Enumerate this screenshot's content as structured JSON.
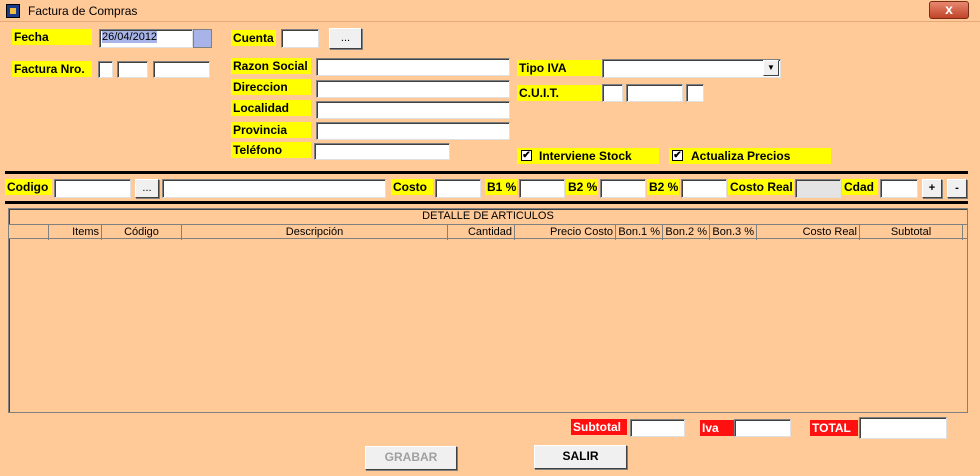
{
  "window": {
    "title": "Factura de Compras",
    "close_glyph": "x"
  },
  "header": {
    "fecha_label": "Fecha",
    "fecha_value": "26/04/2012",
    "factura_label": "Factura Nro.",
    "cuenta_label": "Cuenta",
    "cuenta_button": "...",
    "razon_social_label": "Razon Social",
    "direccion_label": "Direccion",
    "localidad_label": "Localidad",
    "provincia_label": "Provincia",
    "telefono_label": "Teléfono",
    "tipo_iva_label": "Tipo IVA",
    "cuit_label": "C.U.I.T.",
    "interviene_stock_label": "Interviene Stock",
    "actualiza_precios_label": "Actualiza Precios",
    "check_glyph": "✔"
  },
  "item_entry": {
    "codigo_label": "Codigo",
    "codigo_button": "...",
    "costo_label": "Costo",
    "b1_label": "B1 %",
    "b2a_label": "B2 %",
    "b2b_label": "B2 %",
    "costo_real_label": "Costo Real",
    "cdad_label": "Cdad",
    "plus_button": "+",
    "minus_button": "-"
  },
  "grid": {
    "caption": "DETALLE DE ARTICULOS",
    "columns": [
      "",
      "Items",
      "Código",
      "Descripción",
      "Cantidad",
      "Precio Costo",
      "Bon.1 %",
      "Bon.2 %",
      "Bon.3 %",
      "Costo Real",
      "Subtotal"
    ]
  },
  "totals": {
    "subtotal_label": "Subtotal",
    "iva_label": "Iva",
    "total_label": "TOTAL"
  },
  "actions": {
    "grabar": "GRABAR",
    "salir": "SALIR"
  },
  "colors": {
    "background": "#ffc998",
    "label_yellow": "#ffff00",
    "label_red": "#ff1010"
  }
}
